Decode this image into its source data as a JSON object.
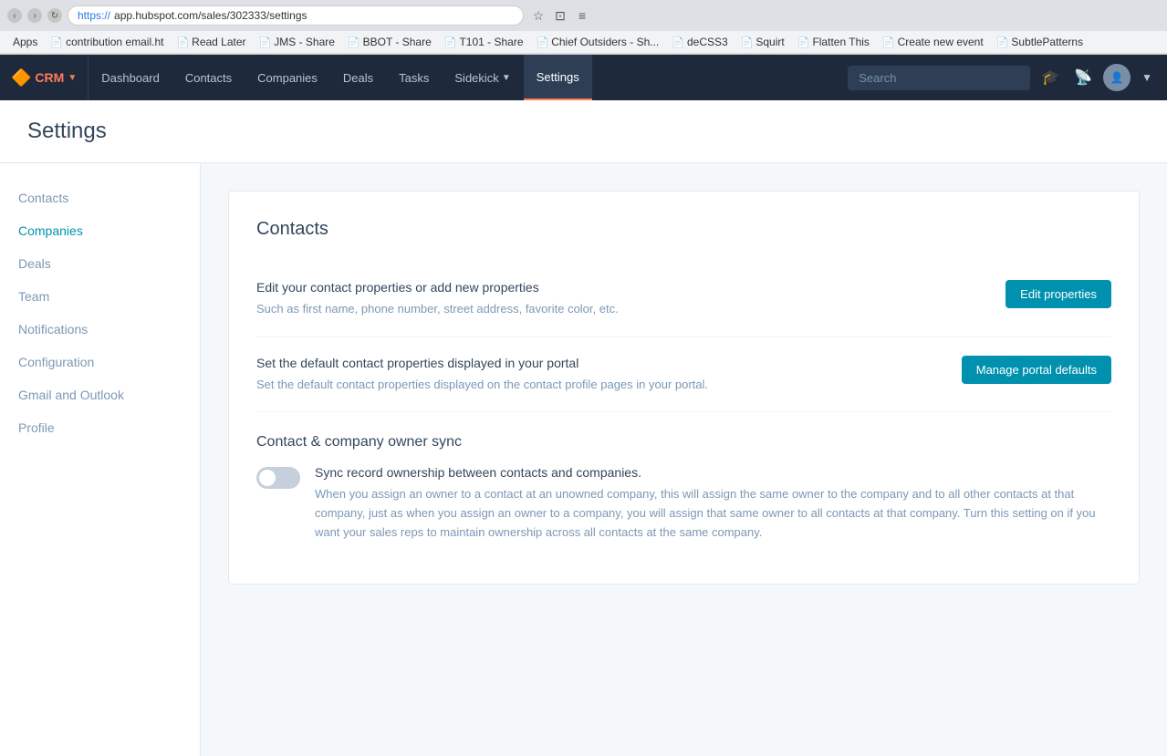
{
  "browser": {
    "url": "https://app.hubspot.com/sales/302333/settings",
    "url_protocol": "https://",
    "url_path": "app.hubspot.com/sales/302333/settings"
  },
  "bookmarks": {
    "apps_label": "Apps",
    "items": [
      {
        "id": "contribution",
        "label": "contribution email.ht",
        "icon": "📄"
      },
      {
        "id": "read-later",
        "label": "Read Later",
        "icon": "📄"
      },
      {
        "id": "jms-share",
        "label": "JMS - Share",
        "icon": "📄"
      },
      {
        "id": "bbot-share",
        "label": "BBOT - Share",
        "icon": "📄"
      },
      {
        "id": "t101-share",
        "label": "T101 - Share",
        "icon": "📄"
      },
      {
        "id": "chief-outsiders",
        "label": "Chief Outsiders - Sh...",
        "icon": "📄"
      },
      {
        "id": "decss3",
        "label": "deCSS3",
        "icon": "📄"
      },
      {
        "id": "squirt",
        "label": "Squirt",
        "icon": "📄"
      },
      {
        "id": "flatten-this",
        "label": "Flatten This",
        "icon": "📄"
      },
      {
        "id": "create-new-event",
        "label": "Create new event",
        "icon": "📄"
      },
      {
        "id": "subtle-patterns",
        "label": "SubtlePatterns",
        "icon": "📄"
      }
    ]
  },
  "nav": {
    "logo_label": "CRM",
    "items": [
      {
        "id": "dashboard",
        "label": "Dashboard"
      },
      {
        "id": "contacts",
        "label": "Contacts"
      },
      {
        "id": "companies",
        "label": "Companies"
      },
      {
        "id": "deals",
        "label": "Deals"
      },
      {
        "id": "tasks",
        "label": "Tasks"
      },
      {
        "id": "sidekick",
        "label": "Sidekick",
        "has_caret": true
      },
      {
        "id": "settings",
        "label": "Settings"
      }
    ],
    "search_placeholder": "Search"
  },
  "page": {
    "title": "Settings"
  },
  "sidebar": {
    "items": [
      {
        "id": "contacts",
        "label": "Contacts",
        "active": false
      },
      {
        "id": "companies",
        "label": "Companies",
        "active": true
      },
      {
        "id": "deals",
        "label": "Deals",
        "active": false
      },
      {
        "id": "team",
        "label": "Team",
        "active": false
      },
      {
        "id": "notifications",
        "label": "Notifications",
        "active": false
      },
      {
        "id": "configuration",
        "label": "Configuration",
        "active": false
      },
      {
        "id": "gmail-outlook",
        "label": "Gmail and Outlook",
        "active": false
      },
      {
        "id": "profile",
        "label": "Profile",
        "active": false
      }
    ]
  },
  "content": {
    "section_title": "Contacts",
    "rows": [
      {
        "id": "edit-properties",
        "title": "Edit your contact properties or add new properties",
        "description": "Such as first name, phone number, street address, favorite color, etc.",
        "button_label": "Edit properties"
      },
      {
        "id": "portal-defaults",
        "title": "Set the default contact properties displayed in your portal",
        "description": "Set the default contact properties displayed on the contact profile pages in your portal.",
        "button_label": "Manage portal defaults"
      }
    ],
    "sync_section": {
      "title": "Contact & company owner sync",
      "toggle_label": "Sync record ownership between contacts and companies.",
      "toggle_description": "When you assign an owner to a contact at an unowned company, this will assign the same owner to the company and to all other contacts at that company, just as when you assign an owner to a company, you will assign that same owner to all contacts at that company. Turn this setting on if you want your sales reps to maintain ownership across all contacts at the same company.",
      "toggle_enabled": false
    }
  }
}
